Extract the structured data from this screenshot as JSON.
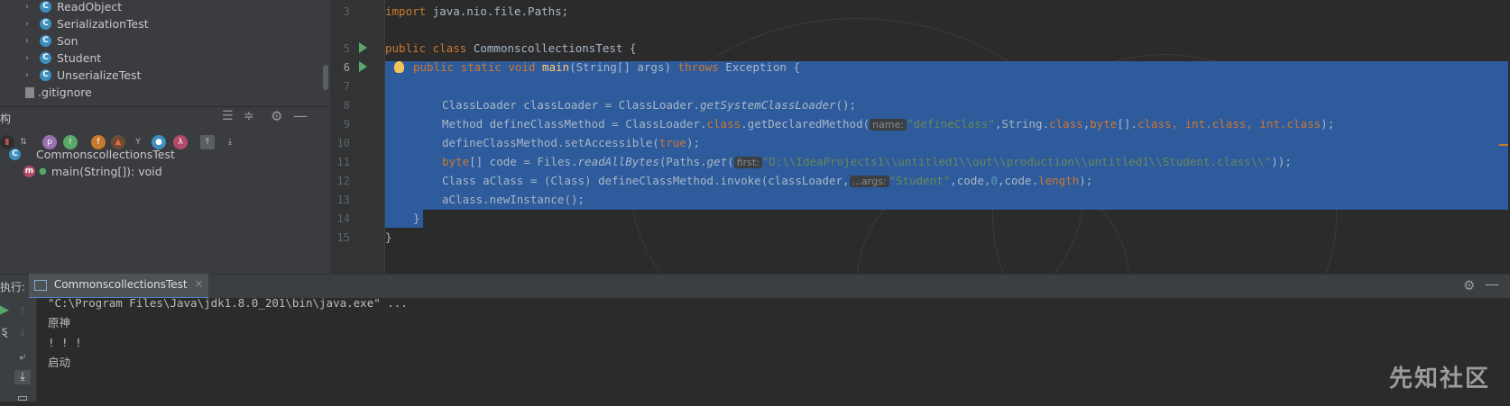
{
  "project_tree": {
    "items": [
      {
        "label": "ReadObject",
        "icon": "class-icon"
      },
      {
        "label": "SerializationTest",
        "icon": "class-icon"
      },
      {
        "label": "Son",
        "icon": "class-icon"
      },
      {
        "label": "Student",
        "icon": "class-icon"
      },
      {
        "label": "UnserializeTest",
        "icon": "class-icon"
      }
    ],
    "gitignore": ".gitignore"
  },
  "structure": {
    "title": "构",
    "class_name": "CommonscollectionsTest",
    "method": "main(String[]): void",
    "method_icon_letter": "m",
    "class_icon_letter": "C"
  },
  "editor": {
    "line_numbers": [
      "3",
      "5",
      "6",
      "7",
      "8",
      "9",
      "10",
      "11",
      "12",
      "13",
      "14",
      "15"
    ],
    "lines": {
      "l3_kw": "import",
      "l3_rest": " java.nio.file.Paths;",
      "l5_kw": "public class",
      "l5_name": " CommonscollectionsTest {",
      "l6_kw1": "public static void",
      "l6_fn": "main",
      "l6_args": "(String[] args) ",
      "l6_kw2": "throws",
      "l6_rest": " Exception {",
      "l8_a": "ClassLoader classLoader = ClassLoader.",
      "l8_it": "getSystemClassLoader",
      "l8_b": "();",
      "l9_a": "Method defineClassMethod = ClassLoader.",
      "l9_kw": "class",
      "l9_b": ".getDeclaredMethod(",
      "l9_hint": "name:",
      "l9_str": "\"defineClass\"",
      "l9_c": ",String.",
      "l9_kw2": "class",
      "l9_d": ",",
      "l9_kw3": "byte",
      "l9_e": "[].",
      "l9_kw4": "class, int.class, int.class",
      "l9_f": ");",
      "l10_a": "defineClassMethod.setAccessible(",
      "l10_kw": "true",
      "l10_b": ");",
      "l11_kw": "byte",
      "l11_a": "[] code = Files.",
      "l11_it": "readAllBytes",
      "l11_b": "(Paths.",
      "l11_it2": "get",
      "l11_c": "(",
      "l11_hint": "first:",
      "l11_str": "\"D:\\\\IdeaProjects1\\\\untitled1\\\\out\\\\production\\\\untitled1\\\\Student.class\\\\\"",
      "l11_d": "));",
      "l12_a": "Class aClass = (Class) defineClassMethod.invoke(classLoader,",
      "l12_hint": "...args:",
      "l12_str": "\"Student\"",
      "l12_b": ",code,",
      "l12_num": "0",
      "l12_c": ",code.",
      "l12_kw": "length",
      "l12_d": ");",
      "l13": "aClass.newInstance();",
      "l14": "}",
      "l15": "}"
    }
  },
  "run_panel": {
    "label": "执行:",
    "tab_title": "CommonscollectionsTest",
    "close": "×",
    "output": [
      "\"C:\\Program Files\\Java\\jdk1.8.0_201\\bin\\java.exe\" ...",
      "原神",
      "! ! !",
      "启动"
    ]
  },
  "watermark": "先知社区",
  "colors": {
    "selection": "#2f5fa6",
    "keyword": "#cc7832",
    "string": "#6a8759",
    "function": "#ffc66d",
    "number": "#6897bb"
  }
}
